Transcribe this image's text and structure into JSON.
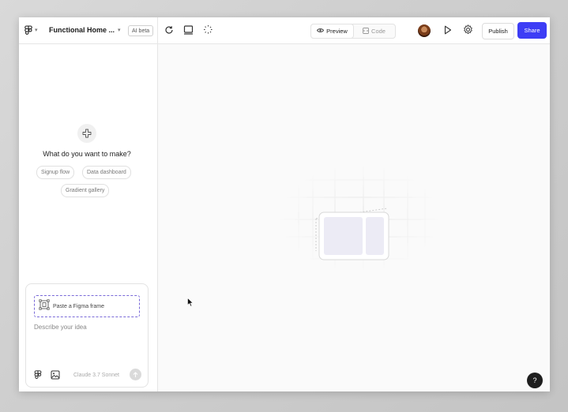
{
  "header": {
    "project_title": "Functional Home ...",
    "ai_badge": "AI beta",
    "view_tabs": [
      {
        "label": "Preview",
        "active": true
      },
      {
        "label": "Code",
        "active": false
      }
    ],
    "publish_label": "Publish",
    "share_label": "Share"
  },
  "left_panel": {
    "prompt_title": "What do you want to make?",
    "suggestions": [
      "Signup flow",
      "Data dashboard",
      "Gradient gallery"
    ],
    "composer": {
      "figma_frame_label": "Paste a Figma frame",
      "placeholder": "Describe your idea",
      "model": "Claude 3.7 Sonnet"
    }
  },
  "help_label": "?",
  "colors": {
    "accent": "#3d3df5",
    "frame_dash": "#7a6ad8"
  }
}
